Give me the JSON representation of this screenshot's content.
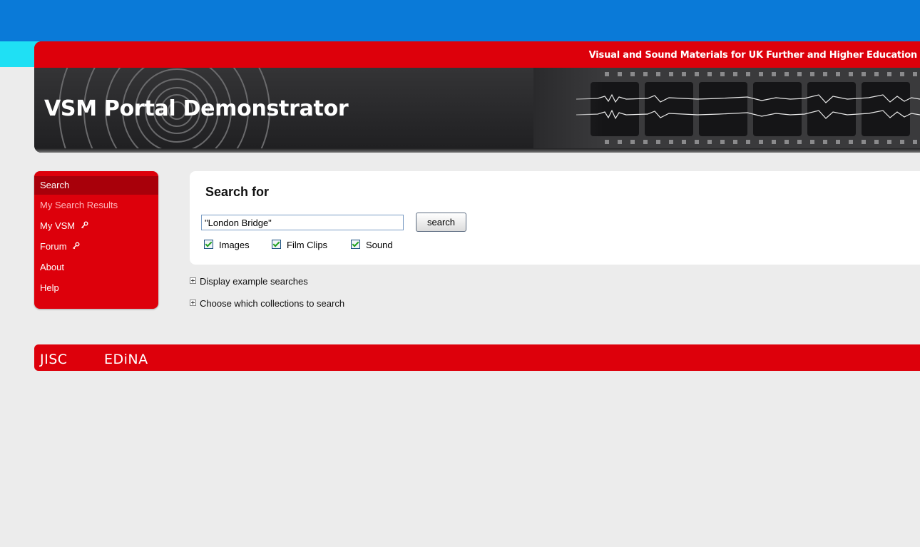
{
  "header": {
    "tagline": "Visual and Sound Materials for UK Further and Higher Education",
    "title": "VSM Portal Demonstrator"
  },
  "sidebar": {
    "items": [
      {
        "label": "Search",
        "active": true,
        "key_icon": false
      },
      {
        "label": "My Search Results",
        "muted": true,
        "key_icon": false
      },
      {
        "label": "My VSM",
        "key_icon": true
      },
      {
        "label": "Forum",
        "key_icon": true
      },
      {
        "label": "About",
        "key_icon": false
      },
      {
        "label": "Help",
        "key_icon": false
      }
    ]
  },
  "search": {
    "heading": "Search for",
    "query": "\"London Bridge\"",
    "button_label": "search",
    "types": [
      {
        "label": "Images",
        "checked": true
      },
      {
        "label": "Film Clips",
        "checked": true
      },
      {
        "label": "Sound",
        "checked": true
      }
    ]
  },
  "toggles": {
    "examples": "Display example searches",
    "collections": "Choose which collections to search"
  },
  "footer": {
    "logo1": "JISC",
    "logo2": "EDiNA"
  },
  "colors": {
    "top_blue": "#0a7ad8",
    "brand_red": "#dd000b",
    "active_red": "#a8000a",
    "header_dark": "#2a2a2c"
  }
}
